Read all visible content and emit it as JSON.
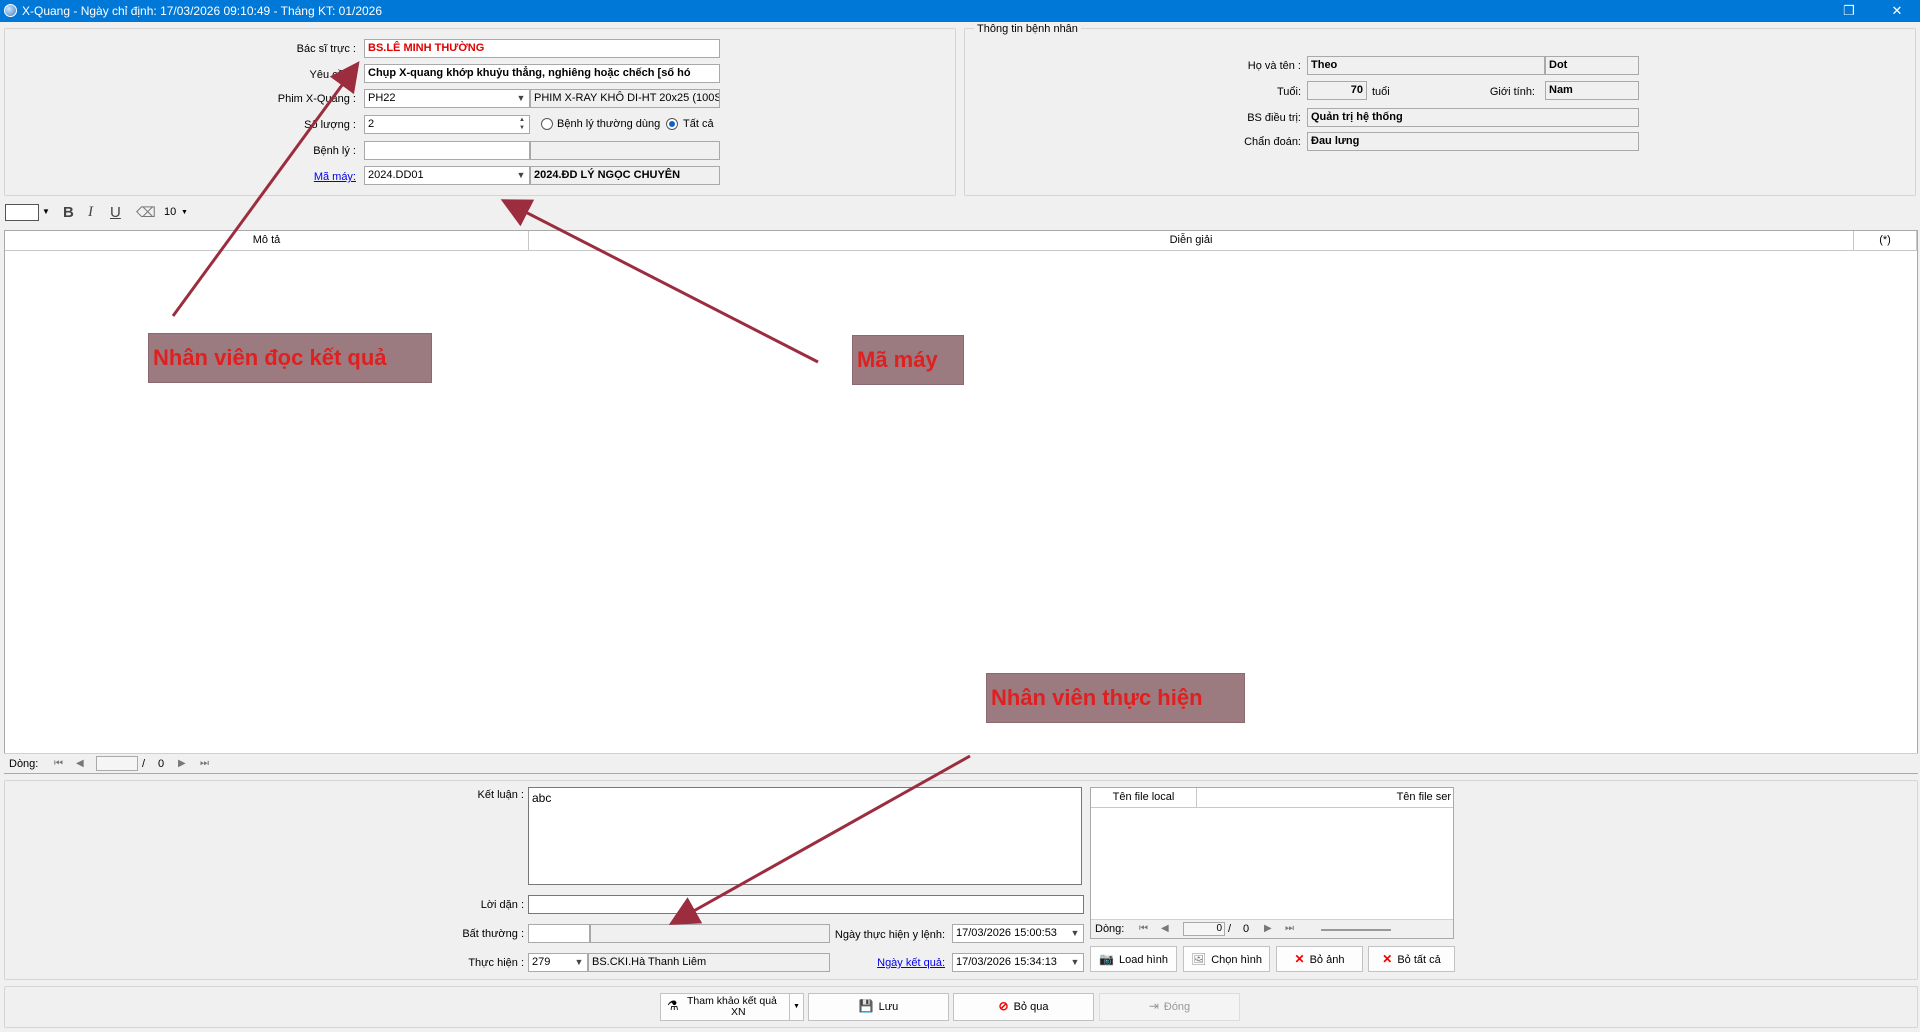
{
  "window": {
    "title": "X-Quang - Ngày chỉ định: 17/03/2026 09:10:49 - Tháng KT: 01/2026",
    "restore_glyph": "❐",
    "close_glyph": "✕"
  },
  "order": {
    "bac_si_label": "Bác sĩ trực :",
    "bac_si_value": "BS.LÊ MINH THƯỜNG",
    "yeu_cau_label": "Yêu cầu :",
    "yeu_cau_value": "Chụp X-quang khớp khuỷu thẳng, nghiêng hoặc chếch [số hó",
    "phim_label": "Phim X-Quang :",
    "phim_code": "PH22",
    "phim_name": "PHIM X-RAY KHÔ DI-HT 20x25 (100S",
    "so_luong_label": "Số lượng :",
    "so_luong_value": "2",
    "radio_common": "Bệnh lý thường dùng",
    "radio_all": "Tất cả",
    "benh_ly_label": "Bệnh lý :",
    "benh_ly_code": "",
    "benh_ly_name": "",
    "ma_may_label": "Mã máy:",
    "ma_may_code": "2024.DD01",
    "ma_may_name": "2024.ĐD LÝ NGỌC CHUYÊN"
  },
  "patient": {
    "group_title": "Thông tin bệnh nhân",
    "name_label": "Họ và tên :",
    "first_name": "Theo",
    "last_name": "Dot",
    "age_label": "Tuổi:",
    "age_value": "70",
    "age_unit": "tuổi",
    "gender_label": "Giới tính:",
    "gender_value": "Nam",
    "doctor_label": "BS điều trị:",
    "doctor_value": "Quản trị hệ thống",
    "diagnosis_label": "Chẩn đoán:",
    "diagnosis_value": "Đau lưng"
  },
  "toolbar": {
    "bold": "B",
    "italic": "I",
    "underline": "U",
    "font_size": "10"
  },
  "grid": {
    "columns": [
      "Mô tả",
      "Diễn giải",
      "(*)"
    ],
    "nav_label": "Dòng:",
    "nav_current": "",
    "nav_sep": "/",
    "nav_total": "0"
  },
  "result": {
    "ket_luan_label": "Kết luận :",
    "ket_luan_value": "abc",
    "loi_dan_label": "Lời dặn :",
    "loi_dan_value": "",
    "bat_thuong_label": "Bất thường :",
    "bat_thuong_code": "",
    "bat_thuong_name": "",
    "thuc_hien_label": "Thực hiện :",
    "thuc_hien_code": "279",
    "thuc_hien_name": "BS.CKI.Hà Thanh Liêm",
    "ngay_thuc_hien_label": "Ngày thực hiện y lệnh:",
    "ngay_thuc_hien_value": "17/03/2026 15:00:53",
    "ngay_ket_qua_label": "Ngày kết quả:",
    "ngay_ket_qua_value": "17/03/2026 15:34:13"
  },
  "files": {
    "col_local": "Tên file local",
    "col_server": "Tên file ser",
    "nav_label": "Dòng:",
    "nav_current": "0",
    "nav_sep": "/",
    "nav_total": "0",
    "btn_load": "Load hình",
    "btn_choose": "Chọn hình",
    "btn_remove": "Bỏ ảnh",
    "btn_remove_all": "Bỏ tất cả"
  },
  "actions": {
    "ref_line1": "Tham khảo kết quả",
    "ref_line2": "XN",
    "save": "Lưu",
    "skip": "Bỏ qua",
    "close": "Đóng"
  },
  "annotations": {
    "reader": "Nhân viên đọc kết quả",
    "machine": "Mã máy",
    "performer": "Nhân viên thực hiện",
    "color": "#9b2d3e"
  }
}
